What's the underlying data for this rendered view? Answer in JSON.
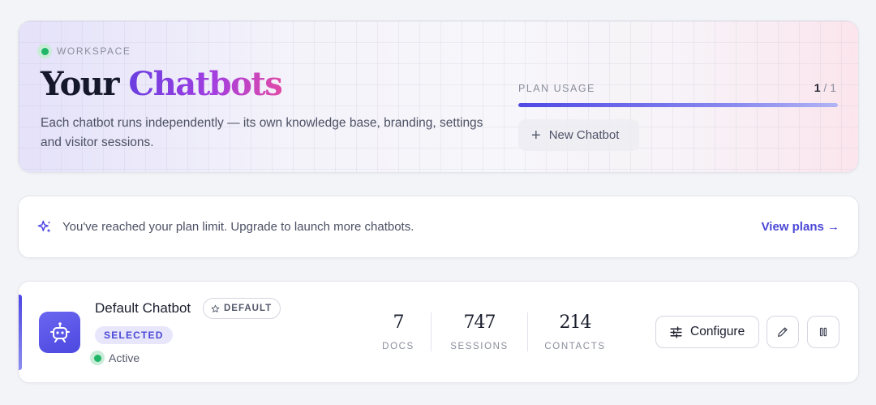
{
  "header": {
    "eyebrow": "WORKSPACE",
    "title_plain": "Your",
    "title_accent": "Chatbots",
    "description": "Each chatbot runs independently — its own knowledge base, branding, settings and visitor sessions.",
    "plan_usage_label": "PLAN USAGE",
    "plan_usage_used": "1",
    "plan_usage_separator": "/",
    "plan_usage_total": "1",
    "plan_usage_fraction": 1.0,
    "new_chatbot_label": "New Chatbot"
  },
  "notice": {
    "icon": "sparkles-icon",
    "message": "You've reached your plan limit. Upgrade to launch more chatbots.",
    "link_label": "View plans →"
  },
  "chatbots": [
    {
      "name": "Default Chatbot",
      "default_badge": "DEFAULT",
      "selected_badge": "SELECTED",
      "status": "Active",
      "stats": [
        {
          "value": "7",
          "label": "DOCS"
        },
        {
          "value": "747",
          "label": "SESSIONS"
        },
        {
          "value": "214",
          "label": "CONTACTS"
        }
      ],
      "configure_label": "Configure"
    }
  ],
  "colors": {
    "accent": "#4f46e5",
    "status_active": "#1fb667",
    "title_gradient_start": "#6a3fe0",
    "title_gradient_end": "#e04aa8"
  }
}
